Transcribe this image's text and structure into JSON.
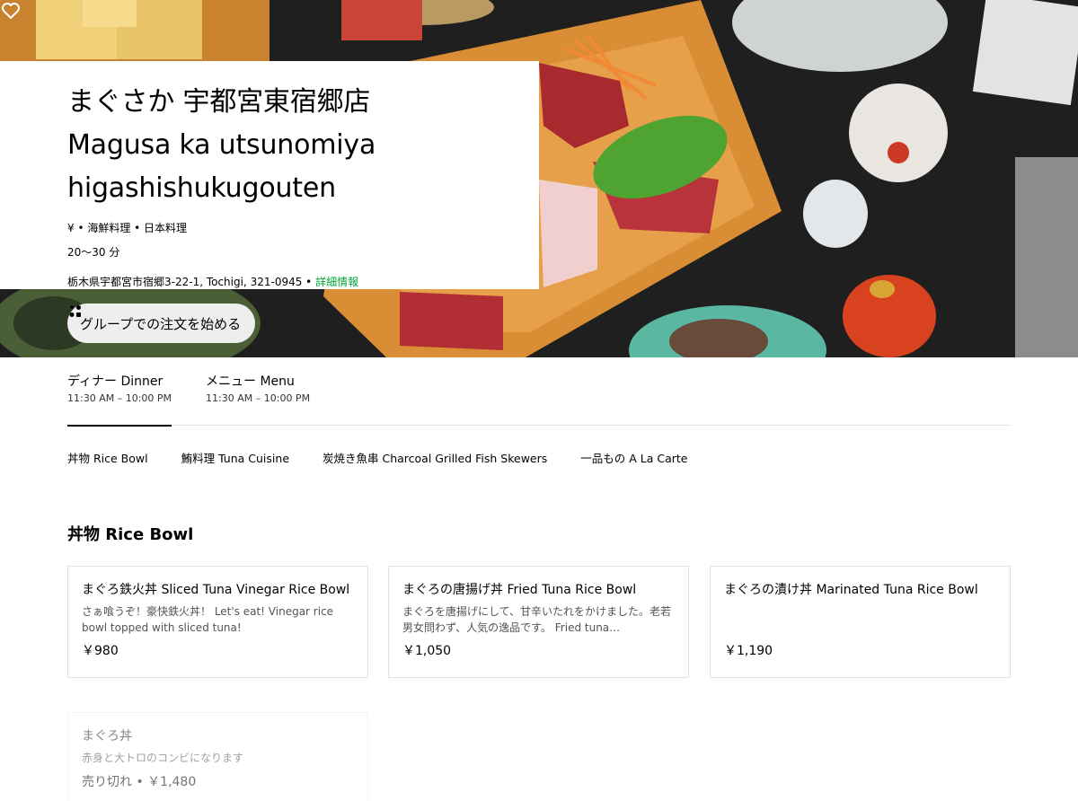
{
  "store": {
    "name": "まぐさか 宇都宮東宿郷店 Magusa ka utsunomiya higashishukugouten",
    "tags": "¥ • 海鮮料理 • 日本料理",
    "eta": "20～30 分",
    "address": "栃木県宇都宮市宿郷3-22-1, Tochigi, 321-0945 • ",
    "detail_link": "詳細情報"
  },
  "actions": {
    "group_order_label": "グループでの注文を始める"
  },
  "menus": [
    {
      "name": "ディナー Dinner",
      "hours": "11:30 AM – 10:00 PM",
      "active": true
    },
    {
      "name": "メニュー Menu",
      "hours": "11:30 AM – 10:00 PM",
      "active": false
    }
  ],
  "categories": [
    "丼物 Rice Bowl",
    "鮪料理 Tuna Cuisine",
    "炭焼き魚串 Charcoal Grilled Fish Skewers",
    "一品もの A La Carte"
  ],
  "section": {
    "title": "丼物 Rice Bowl",
    "items": [
      {
        "name": "まぐろ鉄火丼 Sliced Tuna Vinegar Rice Bowl",
        "description": "さぁ喰うぞ！豪快鉄火丼！ Let's eat! Vinegar rice bowl topped with sliced tuna!",
        "price": "￥980"
      },
      {
        "name": "まぐろの唐揚げ丼 Fried Tuna Rice Bowl",
        "description": "まぐろを唐揚げにして、甘辛いたれをかけました。老若男女問わず、人気の逸品です。 Fried tuna…",
        "price": "￥1,050"
      },
      {
        "name": "まぐろの漬け丼 Marinated Tuna Rice Bowl",
        "description": "",
        "price": "￥1,190"
      },
      {
        "name": "まぐろ丼",
        "description": "赤身と大トロのコンビになります",
        "price": "売り切れ • ￥1,480",
        "sold_out": true
      }
    ]
  },
  "colors": {
    "accent_link": "#06a23b",
    "border": "#e2e2e2",
    "button_bg": "#eeeeee"
  },
  "icons": {
    "group": "group-people-icon",
    "favorite": "heart-outline-icon"
  }
}
